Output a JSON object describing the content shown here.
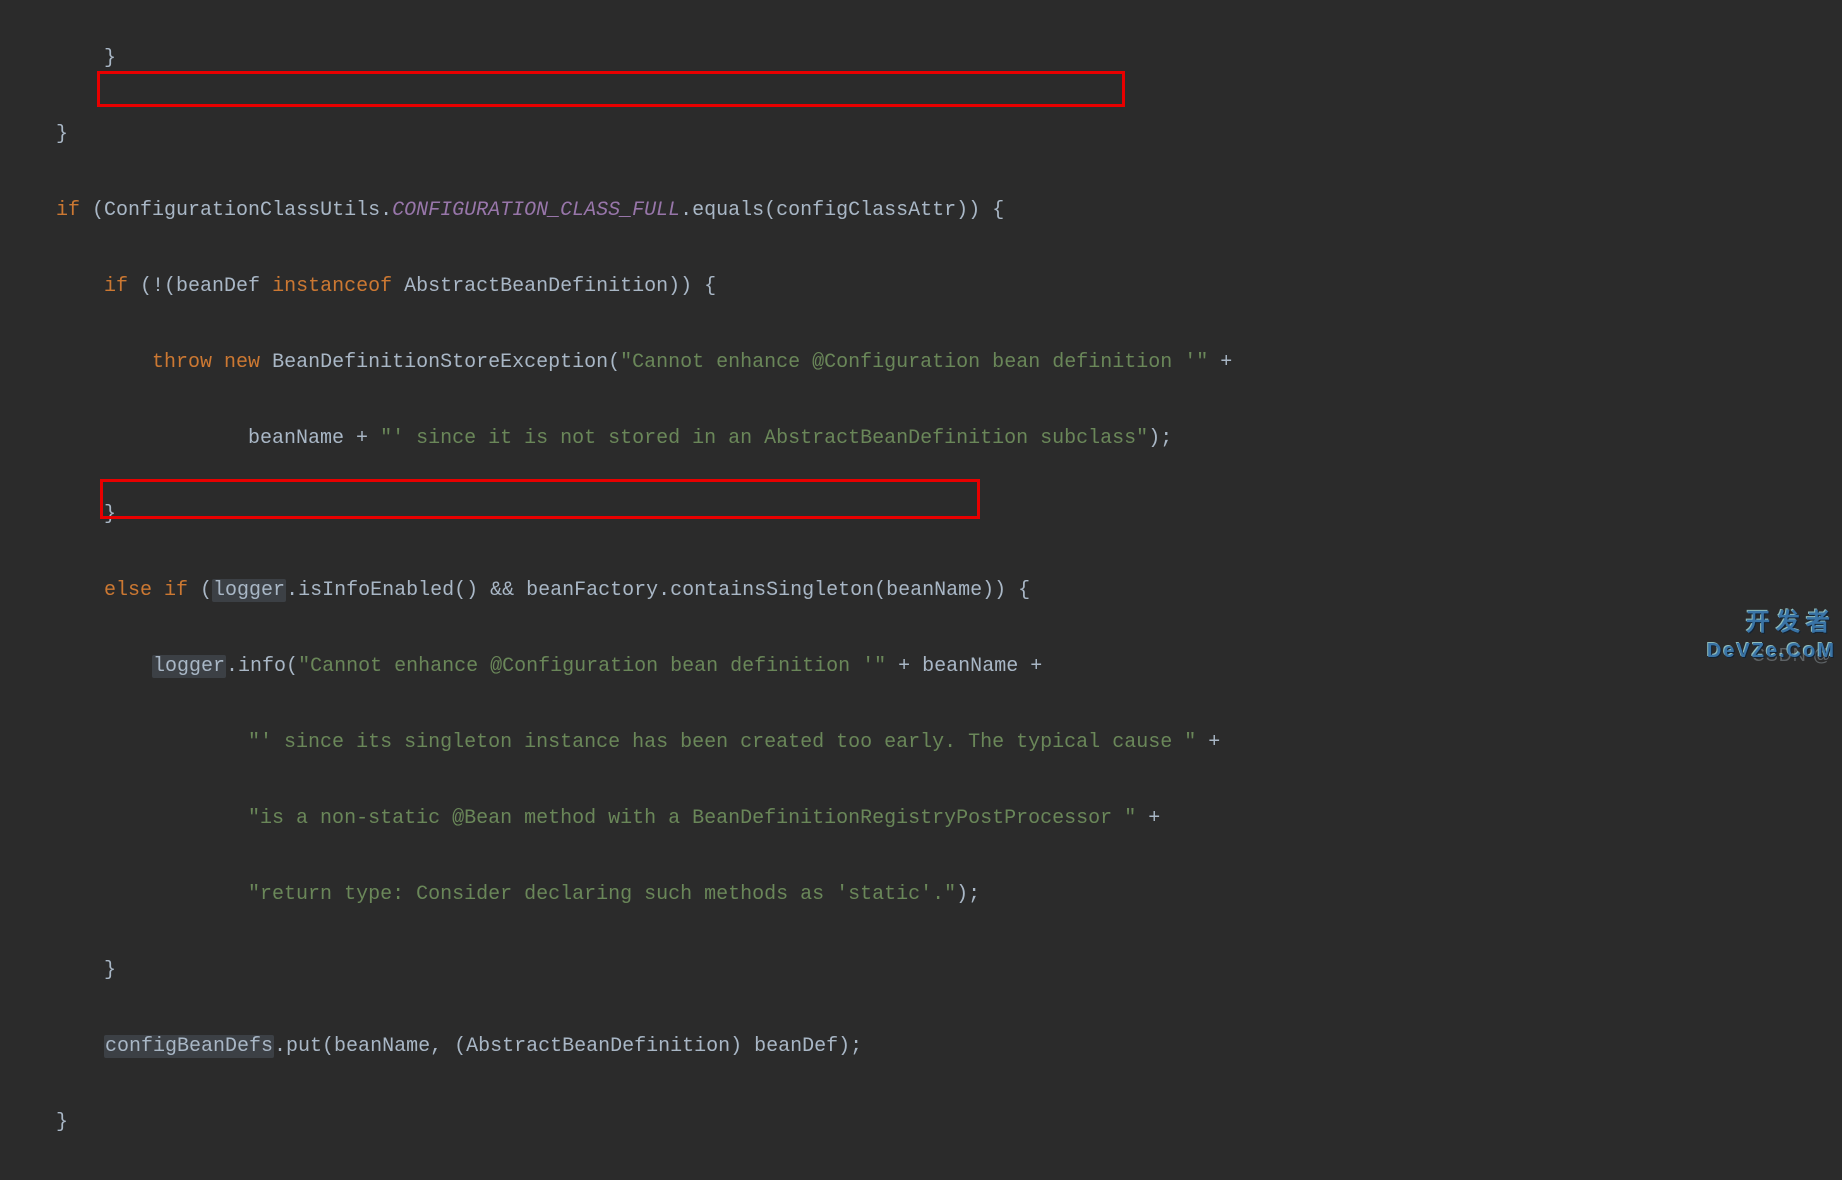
{
  "code": {
    "l1": "        }",
    "l2": "    }",
    "l3_pre": "    ",
    "l3_if": "if",
    "l3_rest1": " (ConfigurationClassUtils.",
    "l3_const": "CONFIGURATION_CLASS_FULL",
    "l3_rest2": ".equals(configClassAttr)) {",
    "l4_pre": "        ",
    "l4_if": "if",
    "l4_rest1": " (!(beanDef ",
    "l4_instanceof": "instanceof",
    "l4_rest2": " AbstractBeanDefinition)) {",
    "l5_pre": "            ",
    "l5_throw": "throw new",
    "l5_rest1": " BeanDefinitionStoreException(",
    "l5_str1": "\"Cannot enhance @Configuration bean definition '\"",
    "l5_rest2": " +",
    "l6_pre": "                    beanName + ",
    "l6_str": "\"' since it is not stored in an AbstractBeanDefinition subclass\"",
    "l6_rest": ");",
    "l7": "        }",
    "l8_pre": "        ",
    "l8_else": "else if",
    "l8_rest1": " (",
    "l8_logger": "logger",
    "l8_rest2": ".isInfoEnabled() && beanFactory.containsSingleton(beanName)) {",
    "l9_pre": "            ",
    "l9_logger": "logger",
    "l9_rest1": ".info(",
    "l9_str": "\"Cannot enhance @Configuration bean definition '\"",
    "l9_rest2": " + beanName +",
    "l10_pre": "                    ",
    "l10_str": "\"' since its singleton instance has been created too early. The typical cause \"",
    "l10_rest": " +",
    "l11_pre": "                    ",
    "l11_str": "\"is a non-static @Bean method with a BeanDefinitionRegistryPostProcessor \"",
    "l11_rest": " +",
    "l12_pre": "                    ",
    "l12_str": "\"return type: Consider declaring such methods as 'static'.\"",
    "l12_rest": ");",
    "l13": "        }",
    "l14_pre": "        ",
    "l14_call": "configBeanDefs",
    "l14_rest": ".put(beanName, (AbstractBeanDefinition) beanDef);",
    "l15": "    }"
  },
  "watermarks": {
    "csdn": "CSDN @",
    "kaifazhe": "开发者",
    "devze": "DeVZe.CoM"
  }
}
